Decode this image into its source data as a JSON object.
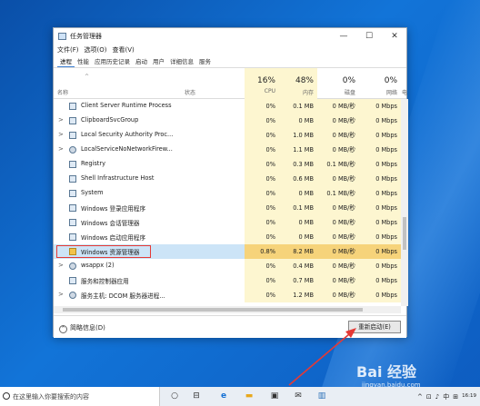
{
  "window": {
    "title": "任务管理器",
    "controls": {
      "minimize": "—",
      "maximize": "☐",
      "close": "✕"
    }
  },
  "menu": [
    "文件(F)",
    "选项(O)",
    "查看(V)"
  ],
  "tabs": [
    "进程",
    "性能",
    "应用历史记录",
    "启动",
    "用户",
    "详细信息",
    "服务"
  ],
  "header": {
    "sort_caret": "^",
    "name": "名称",
    "status": "状态",
    "cpu": {
      "pct": "16%",
      "label": "CPU"
    },
    "memory": {
      "pct": "48%",
      "label": "内存"
    },
    "disk": {
      "pct": "0%",
      "label": "磁盘"
    },
    "network": {
      "pct": "0%",
      "label": "网络"
    },
    "power": "电"
  },
  "rows": [
    {
      "expand": "",
      "icon": "service",
      "name": "Client Server Runtime Process",
      "cpu": "0%",
      "mem": "0.1 MB",
      "disk": "0 MB/秒",
      "net": "0 Mbps"
    },
    {
      "expand": ">",
      "icon": "service",
      "name": "ClipboardSvcGroup",
      "cpu": "0%",
      "mem": "0 MB",
      "disk": "0 MB/秒",
      "net": "0 Mbps"
    },
    {
      "expand": ">",
      "icon": "service",
      "name": "Local Security Authority Proc...",
      "cpu": "0%",
      "mem": "1.0 MB",
      "disk": "0 MB/秒",
      "net": "0 Mbps"
    },
    {
      "expand": ">",
      "icon": "gear",
      "name": "LocalServiceNoNetworkFirew...",
      "cpu": "0%",
      "mem": "1.1 MB",
      "disk": "0 MB/秒",
      "net": "0 Mbps"
    },
    {
      "expand": "",
      "icon": "service",
      "name": "Registry",
      "cpu": "0%",
      "mem": "0.3 MB",
      "disk": "0.1 MB/秒",
      "net": "0 Mbps"
    },
    {
      "expand": "",
      "icon": "service",
      "name": "Shell Infrastructure Host",
      "cpu": "0%",
      "mem": "0.6 MB",
      "disk": "0 MB/秒",
      "net": "0 Mbps"
    },
    {
      "expand": "",
      "icon": "service",
      "name": "System",
      "cpu": "0%",
      "mem": "0 MB",
      "disk": "0.1 MB/秒",
      "net": "0 Mbps"
    },
    {
      "expand": "",
      "icon": "service",
      "name": "Windows 登录应用程序",
      "cpu": "0%",
      "mem": "0.1 MB",
      "disk": "0 MB/秒",
      "net": "0 Mbps"
    },
    {
      "expand": "",
      "icon": "service",
      "name": "Windows 会话管理器",
      "cpu": "0%",
      "mem": "0 MB",
      "disk": "0 MB/秒",
      "net": "0 Mbps"
    },
    {
      "expand": "",
      "icon": "service",
      "name": "Windows 启动应用程序",
      "cpu": "0%",
      "mem": "0 MB",
      "disk": "0 MB/秒",
      "net": "0 Mbps"
    },
    {
      "expand": "",
      "icon": "folder",
      "name": "Windows 资源管理器",
      "cpu": "0.8%",
      "mem": "8.2 MB",
      "disk": "0 MB/秒",
      "net": "0 Mbps",
      "selected": true
    },
    {
      "expand": ">",
      "icon": "gear",
      "name": "wsappx (2)",
      "cpu": "0%",
      "mem": "0.4 MB",
      "disk": "0 MB/秒",
      "net": "0 Mbps"
    },
    {
      "expand": "",
      "icon": "service",
      "name": "服务和控制器应用",
      "cpu": "0%",
      "mem": "0.7 MB",
      "disk": "0 MB/秒",
      "net": "0 Mbps"
    },
    {
      "expand": ">",
      "icon": "gear",
      "name": "服务主机: DCOM 服务器进程...",
      "cpu": "0%",
      "mem": "1.2 MB",
      "disk": "0 MB/秒",
      "net": "0 Mbps"
    }
  ],
  "footer": {
    "less_icon": "^",
    "less_details": "简略信息(D)",
    "restart_button": "重新启动(E)"
  },
  "taskbar": {
    "search_placeholder": "在这里输入你要搜索的内容",
    "tray_ime": "中",
    "clock_time": "16:19"
  },
  "watermark": {
    "brand": "Bai 经验",
    "site": "jingyan.baidu.com"
  }
}
